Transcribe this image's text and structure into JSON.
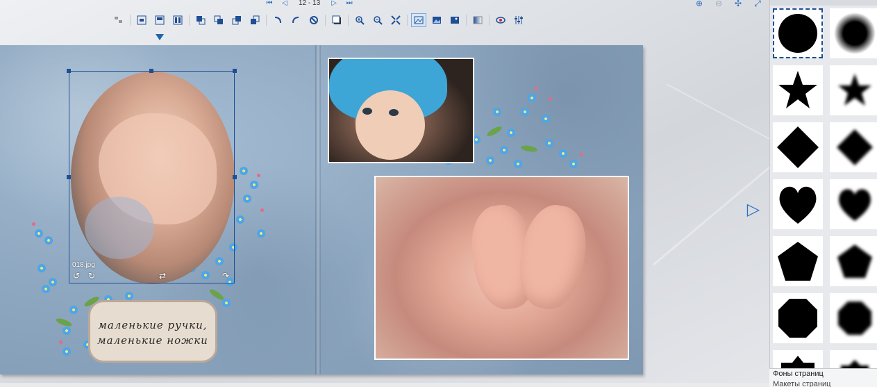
{
  "nav": {
    "first": "⏮",
    "prev": "◁",
    "page_indicator": "12 - 13",
    "next": "▷",
    "last": "⏭"
  },
  "zoom": {
    "zoom_in": "⊕",
    "zoom_out": "⊖",
    "fit": "✣",
    "full": "⤢"
  },
  "toolbar": {
    "active_tool": "tb-photo-frame"
  },
  "album": {
    "image_name": "018.jpg",
    "label_line1": "маленькие ручки,",
    "label_line2": "маленькие ножки",
    "colors": {
      "background": "#8fa8c1",
      "selection": "#1f4e96"
    }
  },
  "controls": {
    "next_page_icon": "▷"
  },
  "panel": {
    "masks": [
      "circle",
      "circle-soft",
      "star",
      "star-soft",
      "diamond",
      "diamond-soft",
      "heart",
      "heart-soft",
      "pentagon",
      "pentagon-soft",
      "octagon",
      "octagon-soft",
      "crown",
      "crown-soft"
    ],
    "selected_mask": "circle",
    "tab_backgrounds": "Фоны страниц",
    "tab_layouts": "Макеты страниц"
  }
}
